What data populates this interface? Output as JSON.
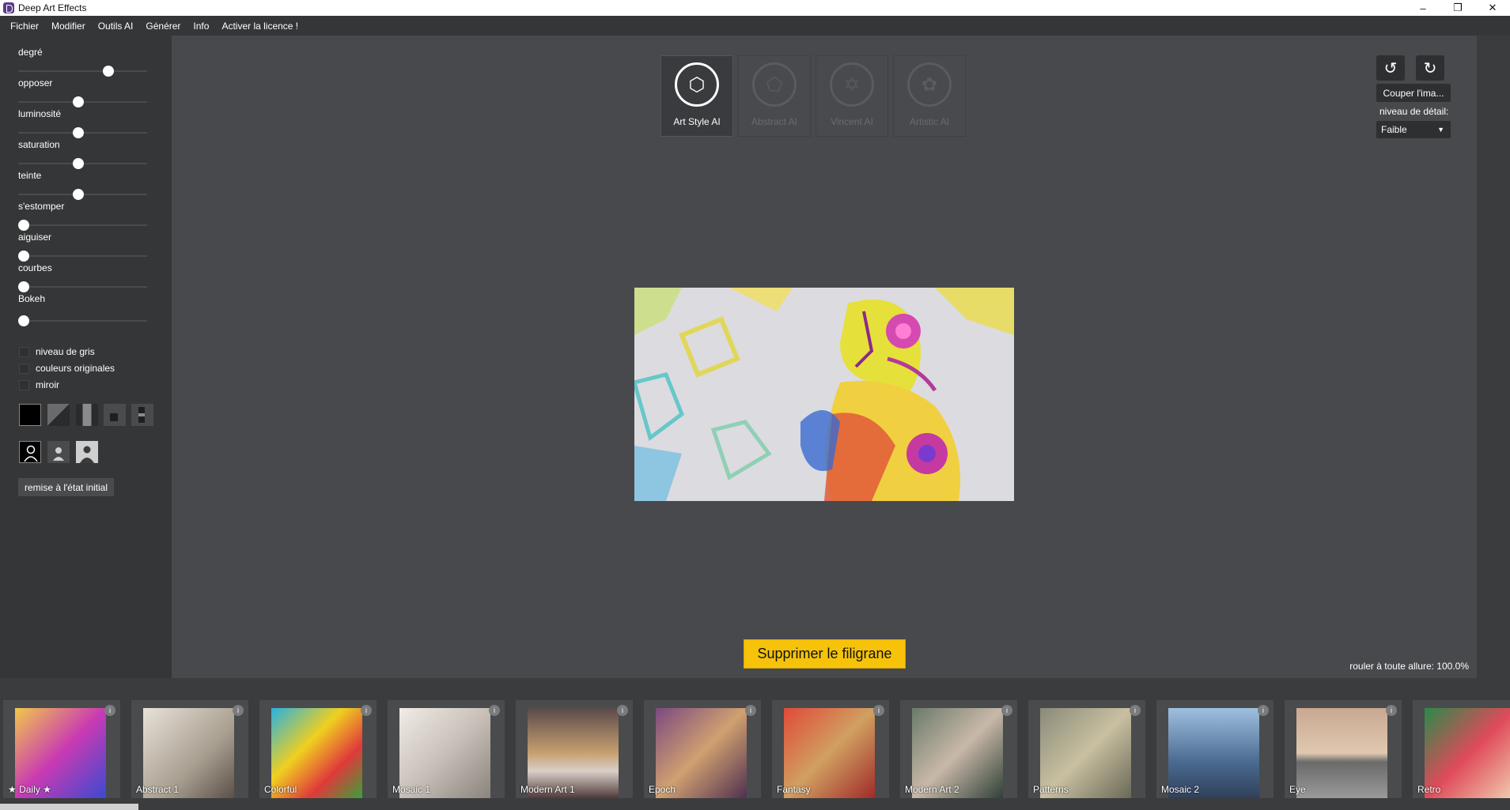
{
  "window": {
    "title": "Deep Art Effects",
    "controls": [
      "–",
      "❐",
      "✕"
    ]
  },
  "menu": [
    "Fichier",
    "Modifier",
    "Outils AI",
    "Générer",
    "Info",
    "Activer la licence !"
  ],
  "sliders": [
    {
      "label": "degré",
      "value": 0.72
    },
    {
      "label": "opposer",
      "value": 0.46
    },
    {
      "label": "luminosité",
      "value": 0.46
    },
    {
      "label": "saturation",
      "value": 0.46
    },
    {
      "label": "teinte",
      "value": 0.46
    },
    {
      "label": "s'estomper",
      "value": 0.0
    },
    {
      "label": "aiguiser",
      "value": 0.0
    },
    {
      "label": "courbes",
      "value": 0.0
    },
    {
      "label": "Bokeh",
      "value": 0.0
    }
  ],
  "checkboxes": [
    {
      "label": "niveau de gris",
      "checked": false
    },
    {
      "label": "couleurs originales",
      "checked": false
    },
    {
      "label": "miroir",
      "checked": false
    }
  ],
  "reset_label": "remise à l'état initial",
  "ai_modes": [
    {
      "label": "Art Style AI",
      "active": true
    },
    {
      "label": "Abstract AI",
      "active": false
    },
    {
      "label": "Vincent AI",
      "active": false
    },
    {
      "label": "Artistic AI",
      "active": false
    }
  ],
  "right_tools": {
    "crop_label": "Couper l'ima...",
    "detail_label": "niveau de détail:",
    "detail_value": "Faible"
  },
  "watermark_label": "Supprimer le filigrane",
  "speed_text": "rouler à toute allure: 100.0%",
  "styles": [
    {
      "name": "★ Daily ★"
    },
    {
      "name": "Abstract 1"
    },
    {
      "name": "Colorful"
    },
    {
      "name": "Mosaic 1"
    },
    {
      "name": "Modern Art 1"
    },
    {
      "name": "Epoch"
    },
    {
      "name": "Fantasy"
    },
    {
      "name": "Modern Art 2"
    },
    {
      "name": "Patterns"
    },
    {
      "name": "Mosaic 2"
    },
    {
      "name": "Eye"
    },
    {
      "name": "Retro"
    }
  ],
  "colors": {
    "accent": "#f6c30a",
    "panel": "#353637",
    "canvas": "#48494c"
  }
}
